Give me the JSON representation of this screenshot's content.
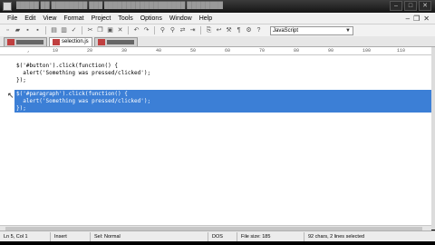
{
  "menu": [
    "File",
    "Edit",
    "View",
    "Format",
    "Project",
    "Tools",
    "Options",
    "Window",
    "Help"
  ],
  "tabs": [
    {
      "label": "",
      "active": false
    },
    {
      "label": "selection.js",
      "active": true
    },
    {
      "label": "",
      "active": false
    }
  ],
  "language": "JavaScript",
  "ruler": [
    ",",
    "10",
    "20",
    "30",
    "40",
    "50",
    "60",
    "70",
    "80",
    "90",
    "100",
    "110"
  ],
  "code": {
    "line1": "$('#button').click(function() {",
    "line2": "  alert('Something was pressed/clicked');",
    "line3": "});",
    "sel1": "$('#paragraph').click(function() {",
    "sel2": "  alert('Something was pressed/clicked');",
    "sel3": "});"
  },
  "status": {
    "position": "Ln 5, Col 1",
    "mode": "Insert",
    "sel_mode": "Sel: Normal",
    "encoding": "DOS",
    "file_size": "File size: 185",
    "selection_info": "92 chars, 2 lines selected"
  }
}
